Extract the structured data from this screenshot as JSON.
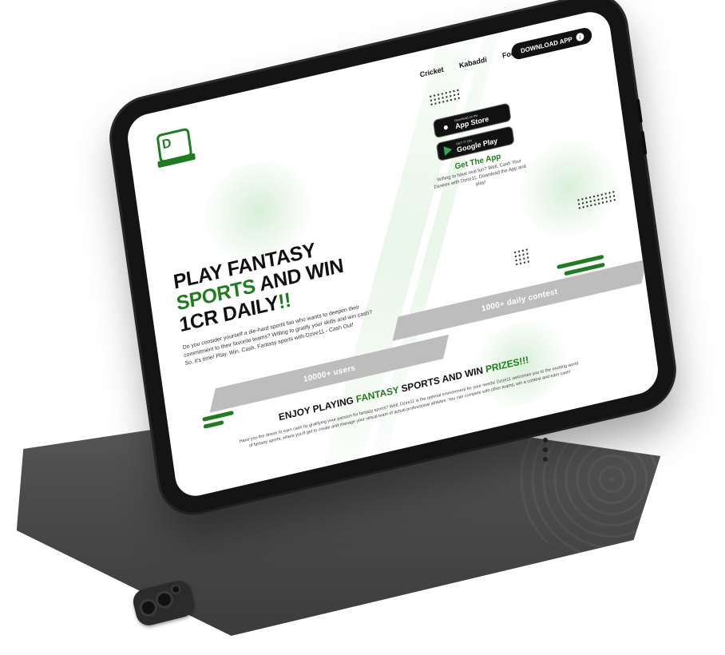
{
  "nav": {
    "items": [
      "Cricket",
      "Kabaddi",
      "Football"
    ],
    "download_label": "DOWNLOAD APP",
    "download_icon": "download-icon"
  },
  "logo": {
    "mark": "D"
  },
  "hero": {
    "headline_part1": "PLAY FANTASY",
    "headline_accent": "SPORTS",
    "headline_part2": " AND WIN 1CR DAILY",
    "headline_exclaim": "!!",
    "body": "Do you consider yourself a die-hard sports fan who wants to deepen their commitment to their favorite teams? Willing to gratify your skills and win cash? So, it's time! Play. Win. Cash. Fantasy sports with Dzire11 - Cash Out!"
  },
  "app": {
    "app_store_small": "Download on the",
    "app_store_big": "App Store",
    "google_play_small": "GET IT ON",
    "google_play_big": "Google Play",
    "get_app_title": "Get The App",
    "get_app_text": "Willing to have real fun? Well, Cash Your Desires with Dzire11. Download the App and play!"
  },
  "stats": {
    "contests": "1000+ daily contest",
    "users": "10000+ users"
  },
  "enjoy": {
    "title_part1": "ENJOY PLAYING ",
    "title_accent1": "FANTASY",
    "title_part2": " SPORTS AND WIN ",
    "title_accent2": "PRIZES!!!",
    "body": "Have you the desire to earn cash by gratifying your passion for fantasy sports? Well, Dzire11 is the optimal environment for your needs! Dzire11 welcomes you to the exciting world of fantasy sports, where you'll get to create and manage your virtual team of actual professional athletes. You can compete with other teams, win a contest and earn cash!"
  },
  "colors": {
    "accent": "#1e7d1e",
    "banner_gray": "#bdbdbd",
    "device_body": "#4a4a4a",
    "bezel": "#141414"
  }
}
